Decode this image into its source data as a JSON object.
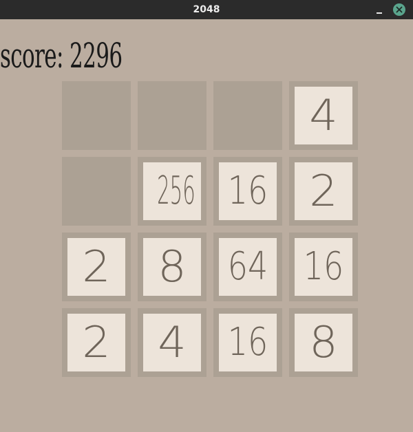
{
  "window": {
    "title": "2048"
  },
  "game": {
    "score_text": "score: 2296",
    "board": [
      [
        "",
        "",
        "",
        "4"
      ],
      [
        "",
        "256",
        "16",
        "2"
      ],
      [
        "2",
        "8",
        "64",
        "16"
      ],
      [
        "2",
        "4",
        "16",
        "8"
      ]
    ]
  },
  "colors": {
    "background": "#bbada0",
    "empty_cell": "#aca194",
    "tile": "#ede4da",
    "tile_text": "#6f655a",
    "titlebar": "#2b2b2b",
    "close_button": "#5aa58d"
  },
  "icons": {
    "minimize": "minimize-icon",
    "close": "close-icon"
  }
}
